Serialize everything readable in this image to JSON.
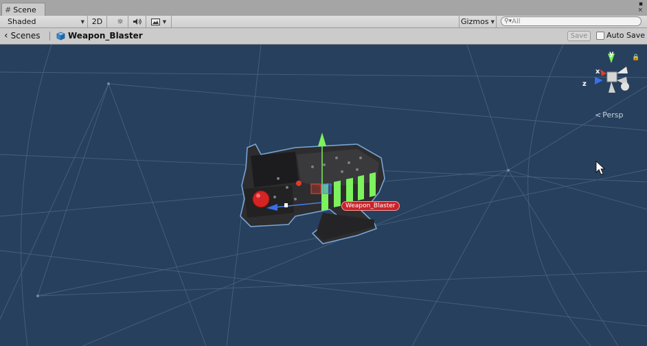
{
  "tab": {
    "title": "Scene",
    "icon": "grid-icon"
  },
  "window_controls": {
    "menu": "▪",
    "close": "×"
  },
  "toolbar": {
    "shading_mode": "Shaded",
    "mode_2d": "2D",
    "lighting_icon": "sun-icon",
    "audio_icon": "speaker-icon",
    "effects_icon": "image-icon",
    "gizmos_label": "Gizmos",
    "search_placeholder": "All"
  },
  "breadcrumb": {
    "root_label": "Scenes",
    "root_icon": "unity-logo-icon",
    "prefab_label": "Weapon_Blaster",
    "prefab_icon": "cube-icon"
  },
  "prefab_mode": {
    "save_label": "Save",
    "auto_save_label": "Auto Save",
    "auto_save_checked": false
  },
  "scene_view": {
    "object_label": "Weapon_Blaster",
    "projection_label": "Persp",
    "axes": {
      "y": "y",
      "x": "x",
      "z": "z"
    },
    "colors": {
      "background": "#27405d",
      "grid": "#4d6a8c",
      "accent_green": "#7cf25c",
      "label_red": "#c8232a"
    }
  }
}
